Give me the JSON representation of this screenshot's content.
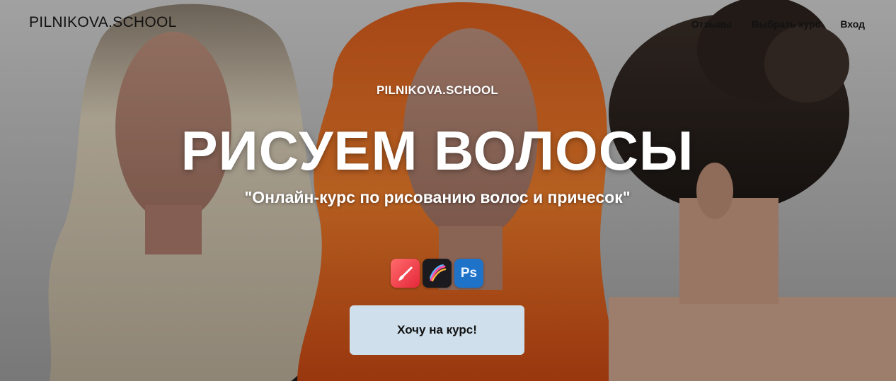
{
  "header": {
    "logo": "PILNIKOVA.SCHOOL",
    "nav": [
      "Отзывы",
      "Выбрать курс",
      "Вход"
    ]
  },
  "hero": {
    "brand": "PILNIKOVA.SCHOOL",
    "title": "РИСУЕМ ВОЛОСЫ",
    "subtitle": "\"Онлайн-курс по рисованию волос и причесок\"",
    "apps": [
      {
        "icon": "paint-brush-icon",
        "label": ""
      },
      {
        "icon": "procreate-icon",
        "label": ""
      },
      {
        "icon": "photoshop-icon",
        "label": "Ps"
      }
    ],
    "cta_label": "Хочу на курс!"
  },
  "colors": {
    "cta_bg": "#cfe0ec",
    "ps_blue": "#1e73c9",
    "paint_red": "#e5273a",
    "procreate_dark": "#1b1b1f"
  }
}
